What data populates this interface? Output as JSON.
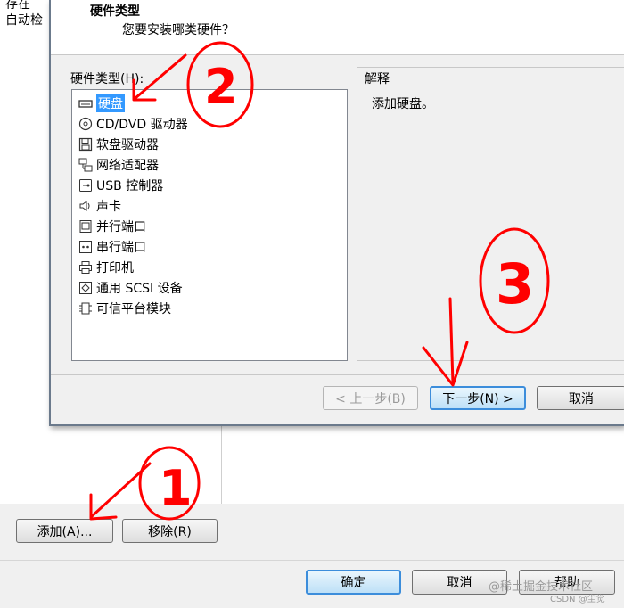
{
  "background": {
    "cut_labels": [
      "存在",
      "自动检"
    ],
    "add_button": "添加(A)...",
    "remove_button": "移除(R)",
    "ok_button": "确定",
    "cancel_button": "取消",
    "help_button": "帮助"
  },
  "wizard": {
    "title": "硬件类型",
    "subtitle": "您要安装哪类硬件？",
    "list_label": "硬件类型(H):",
    "items": [
      {
        "label": "硬盘",
        "icon": "hard-disk-icon",
        "selected": true
      },
      {
        "label": "CD/DVD 驱动器",
        "icon": "cd-dvd-icon"
      },
      {
        "label": "软盘驱动器",
        "icon": "floppy-icon"
      },
      {
        "label": "网络适配器",
        "icon": "network-adapter-icon"
      },
      {
        "label": "USB 控制器",
        "icon": "usb-icon"
      },
      {
        "label": "声卡",
        "icon": "speaker-icon"
      },
      {
        "label": "并行端口",
        "icon": "parallel-port-icon"
      },
      {
        "label": "串行端口",
        "icon": "serial-port-icon"
      },
      {
        "label": "打印机",
        "icon": "printer-icon"
      },
      {
        "label": "通用 SCSI 设备",
        "icon": "scsi-icon"
      },
      {
        "label": "可信平台模块",
        "icon": "tpm-icon"
      }
    ],
    "explain_label": "解释",
    "explain_text": "添加硬盘。",
    "back_button": "< 上一步(B)",
    "next_button": "下一步(N) >",
    "cancel_button": "取消"
  },
  "annotations": {
    "numbers": [
      "①",
      "②",
      "③"
    ],
    "color": "#ff0000"
  },
  "watermark": {
    "line1": "@稀土掘金技术社区",
    "line2": "CSDN @尘觉"
  }
}
